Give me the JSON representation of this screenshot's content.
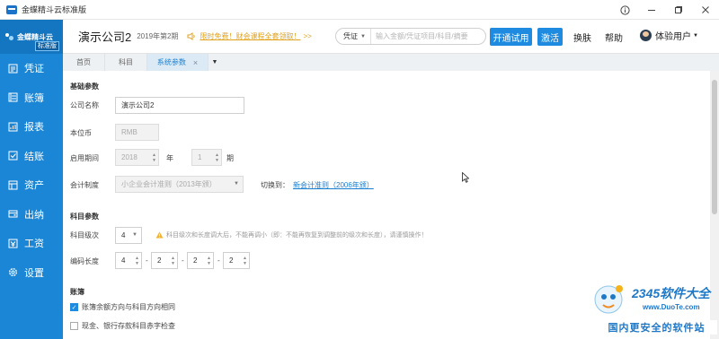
{
  "window": {
    "title": "金蝶精斗云标准版",
    "controls": [
      "info",
      "minimize",
      "maximize",
      "close"
    ]
  },
  "sidebar": {
    "logo_text": "金蝶精斗云",
    "logo_badge": "标准版",
    "items": [
      {
        "label": "凭证",
        "icon": "voucher-icon"
      },
      {
        "label": "账簿",
        "icon": "ledger-icon"
      },
      {
        "label": "报表",
        "icon": "report-icon"
      },
      {
        "label": "结账",
        "icon": "closing-icon"
      },
      {
        "label": "资产",
        "icon": "asset-icon"
      },
      {
        "label": "出纳",
        "icon": "cashier-icon"
      },
      {
        "label": "工资",
        "icon": "payroll-icon"
      },
      {
        "label": "设置",
        "icon": "settings-icon"
      }
    ]
  },
  "header": {
    "company": "演示公司2",
    "period": "2019年第2期",
    "notice": "限时免费！财会课程全套领取！",
    "notice_arrow": ">>",
    "search_type": "凭证",
    "search_placeholder": "输入金额/凭证项目/科目/摘要",
    "trial_button": "开通试用",
    "activate_button": "激活",
    "skin_link": "换肤",
    "help_link": "帮助",
    "user_name": "体验用户"
  },
  "tabs": [
    {
      "label": "首页",
      "active": false
    },
    {
      "label": "科目",
      "active": false
    },
    {
      "label": "系统参数",
      "active": true
    }
  ],
  "basic": {
    "section_title": "基础参数",
    "company_label": "公司名称",
    "company_value": "演示公司2",
    "currency_label": "本位币",
    "currency_value": "RMB",
    "start_label": "启用期间",
    "start_year": "2018",
    "year_unit": "年",
    "start_period": "1",
    "period_unit": "期",
    "system_label": "会计制度",
    "system_value": "小企业会计准则（2013年颁）",
    "switch_label": "切换到：",
    "switch_link": "新会计准则（2006年颁）"
  },
  "subject": {
    "section_title": "科目参数",
    "level_label": "科目级次",
    "level_value": "4",
    "warning": "科目级次和长度调大后，不能再调小（即：不能再恢复到调整前的级次和长度），请谨慎操作！",
    "code_label": "编码长度",
    "code_values": [
      "4",
      "2",
      "2",
      "2"
    ],
    "code_sep": "-"
  },
  "ledger": {
    "section_title": "账簿",
    "option1": {
      "label": "账簿余额方向与科目方向相同",
      "checked": true
    },
    "option2": {
      "label": "现金、银行存款科目赤字检查",
      "checked": false
    }
  },
  "watermark": {
    "brand": "2345软件大全",
    "url": "www.DuoTe.com",
    "slogan": "国内更安全的软件站"
  },
  "colors": {
    "sidebar": "#1b86d5",
    "accent": "#1e8be0",
    "notice": "#e3a21a",
    "link": "#1a7fd0"
  }
}
